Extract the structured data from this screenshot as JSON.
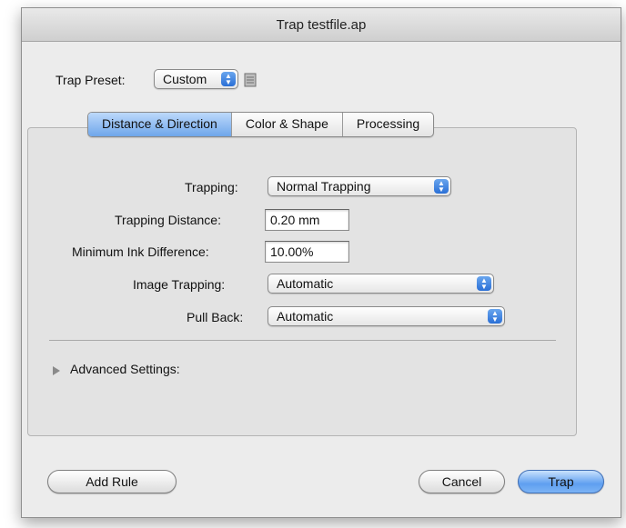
{
  "window": {
    "title": "Trap testfile.ap"
  },
  "preset": {
    "label": "Trap Preset:",
    "value": "Custom",
    "icon": "document-icon"
  },
  "tabs": [
    {
      "label": "Distance & Direction",
      "active": true
    },
    {
      "label": "Color & Shape",
      "active": false
    },
    {
      "label": "Processing",
      "active": false
    }
  ],
  "form": {
    "trapping": {
      "label": "Trapping:",
      "value": "Normal Trapping"
    },
    "trapping_distance": {
      "label": "Trapping Distance:",
      "value": "0.20 mm"
    },
    "min_ink_difference": {
      "label": "Minimum Ink Difference:",
      "value": "10.00%"
    },
    "image_trapping": {
      "label": "Image Trapping:",
      "value": "Automatic"
    },
    "pull_back": {
      "label": "Pull Back:",
      "value": "Automatic"
    }
  },
  "advanced": {
    "label": "Advanced Settings:"
  },
  "buttons": {
    "add_rule": "Add Rule",
    "cancel": "Cancel",
    "trap": "Trap"
  },
  "colors": {
    "accent": "#5f9ff0",
    "window_bg": "#ececec",
    "panel_bg": "#e3e3e3"
  }
}
